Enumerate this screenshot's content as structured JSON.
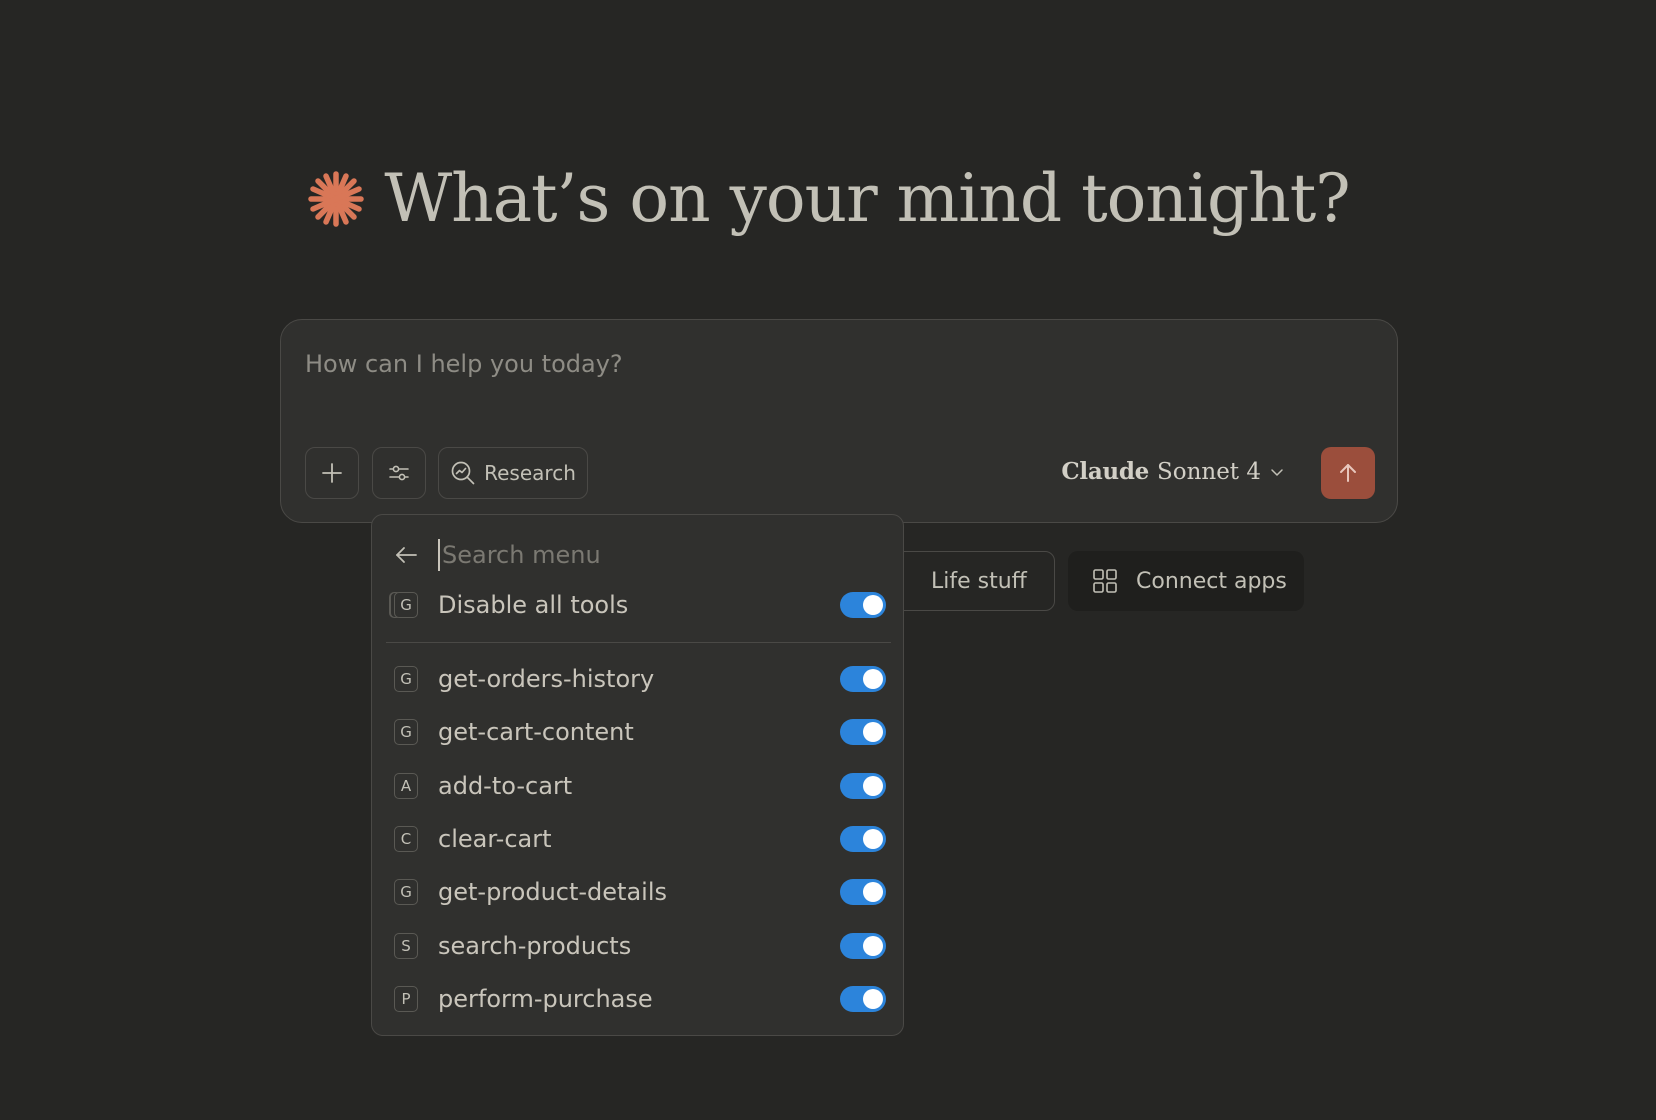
{
  "greeting": {
    "title": "What’s on your mind tonight?",
    "icon": "claude-starburst-icon",
    "accent_color": "#d97757"
  },
  "composer": {
    "placeholder": "How can I help you today?",
    "buttons": {
      "add_icon": "plus-icon",
      "tools_icon": "sliders-icon",
      "research_label": "Research",
      "research_icon": "research-icon"
    },
    "model": {
      "brand": "Claude",
      "name": "Sonnet 4"
    },
    "send_icon": "arrow-up-icon",
    "send_color": "#9b4e3c"
  },
  "chips": [
    {
      "label": "Life stuff",
      "icon": "coffee-icon"
    },
    {
      "label": "Connect apps",
      "icon": "grid-icon"
    }
  ],
  "menu": {
    "search_placeholder": "Search menu",
    "disable_all": {
      "glyph": "G",
      "label": "Disable all tools",
      "enabled": true
    },
    "tools": [
      {
        "glyph": "G",
        "label": "get-orders-history",
        "enabled": true
      },
      {
        "glyph": "G",
        "label": "get-cart-content",
        "enabled": true
      },
      {
        "glyph": "A",
        "label": "add-to-cart",
        "enabled": true
      },
      {
        "glyph": "C",
        "label": "clear-cart",
        "enabled": true
      },
      {
        "glyph": "G",
        "label": "get-product-details",
        "enabled": true
      },
      {
        "glyph": "S",
        "label": "search-products",
        "enabled": true
      },
      {
        "glyph": "P",
        "label": "perform-purchase",
        "enabled": true
      }
    ],
    "toggle_color": "#2c84db"
  }
}
